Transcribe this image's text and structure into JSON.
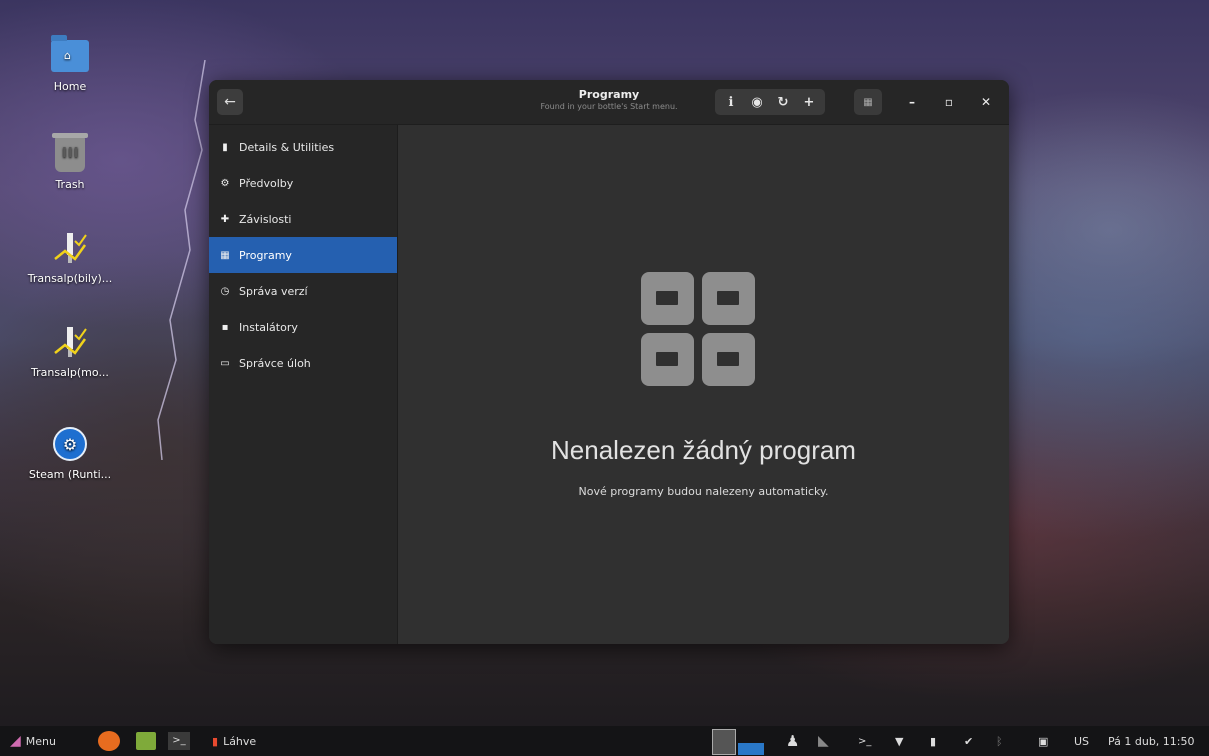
{
  "desktop": {
    "icons": [
      {
        "label": "Home"
      },
      {
        "label": "Trash"
      },
      {
        "label": "Transalp(bily)..."
      },
      {
        "label": "Transalp(mo..."
      },
      {
        "label": "Steam (Runti..."
      }
    ]
  },
  "window": {
    "title": "Programy",
    "subtitle": "Found in your bottle's Start menu.",
    "sidebar": [
      {
        "label": "Details & Utilities",
        "icon": "bottle-icon"
      },
      {
        "label": "Předvolby",
        "icon": "gear-icon"
      },
      {
        "label": "Závislosti",
        "icon": "puzzle-icon"
      },
      {
        "label": "Programy",
        "icon": "apps-grid-icon",
        "active": true
      },
      {
        "label": "Správa verzí",
        "icon": "clock-icon"
      },
      {
        "label": "Instalátory",
        "icon": "installer-icon"
      },
      {
        "label": "Správce úloh",
        "icon": "monitor-icon"
      }
    ],
    "empty": {
      "title": "Nenalezen žádný program",
      "subtitle": "Nové programy budou nalezeny automaticky."
    }
  },
  "taskbar": {
    "menu_label": "Menu",
    "task_label": "Láhve",
    "keyboard_layout": "US",
    "clock": "Pá 1 dub, 11:50"
  },
  "colors": {
    "accent": "#2560b0",
    "window_bg": "#303030",
    "sidebar_bg": "#262626"
  }
}
